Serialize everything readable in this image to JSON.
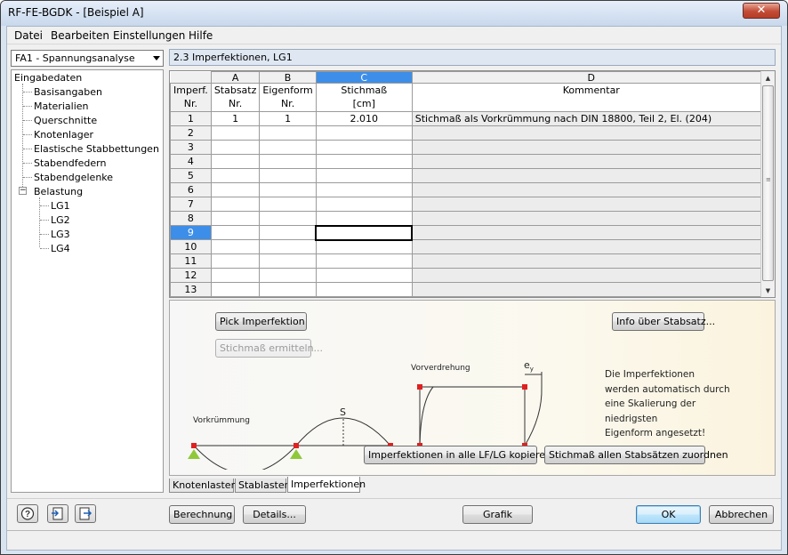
{
  "window": {
    "title": "RF-FE-BGDK - [Beispiel A]",
    "close_label": "✕"
  },
  "menu": [
    "Datei",
    "Bearbeiten",
    "Einstellungen",
    "Hilfe"
  ],
  "case_select": {
    "value": "FA1 - Spannungsanalyse"
  },
  "tree": {
    "root": "Eingabedaten",
    "items": [
      "Basisangaben",
      "Materialien",
      "Querschnitte",
      "Knotenlager",
      "Elastische Stabbettungen",
      "Stabendfedern",
      "Stabendgelenke",
      "Belastung"
    ],
    "load_expander": "−",
    "load_cases": [
      "LG1",
      "LG2",
      "LG3",
      "LG4"
    ]
  },
  "panel_title": "2.3 Imperfektionen, LG1",
  "grid": {
    "col_letters": [
      "A",
      "B",
      "C",
      "D"
    ],
    "header_first": [
      "Imperf.",
      "Nr."
    ],
    "headers": [
      [
        "Stabsatz",
        "Nr."
      ],
      [
        "Eigenform",
        "Nr."
      ],
      [
        "Stichmaß",
        "[cm]"
      ],
      [
        "",
        "Kommentar"
      ]
    ],
    "rows": [
      {
        "nr": "1",
        "a": "1",
        "b": "1",
        "c": "2.010",
        "d": "Stichmaß als Vorkrümmung nach DIN 18800, Teil 2, El. (204)"
      },
      {
        "nr": "2",
        "a": "",
        "b": "",
        "c": "",
        "d": ""
      },
      {
        "nr": "3",
        "a": "",
        "b": "",
        "c": "",
        "d": ""
      },
      {
        "nr": "4",
        "a": "",
        "b": "",
        "c": "",
        "d": ""
      },
      {
        "nr": "5",
        "a": "",
        "b": "",
        "c": "",
        "d": ""
      },
      {
        "nr": "6",
        "a": "",
        "b": "",
        "c": "",
        "d": ""
      },
      {
        "nr": "7",
        "a": "",
        "b": "",
        "c": "",
        "d": ""
      },
      {
        "nr": "8",
        "a": "",
        "b": "",
        "c": "",
        "d": ""
      },
      {
        "nr": "9",
        "a": "",
        "b": "",
        "c": "",
        "d": ""
      },
      {
        "nr": "10",
        "a": "",
        "b": "",
        "c": "",
        "d": ""
      },
      {
        "nr": "11",
        "a": "",
        "b": "",
        "c": "",
        "d": ""
      },
      {
        "nr": "12",
        "a": "",
        "b": "",
        "c": "",
        "d": ""
      },
      {
        "nr": "13",
        "a": "",
        "b": "",
        "c": "",
        "d": ""
      }
    ],
    "selected_row": "9",
    "selected_col": "C"
  },
  "lower": {
    "pick_button": "Pick Imperfektion",
    "ermitteln_button": "Stichmaß ermitteln...",
    "info_button": "Info über Stabsatz...",
    "copy_button": "Imperfektionen in alle LF/LG kopieren",
    "assign_button": "Stichmaß allen Stabsätzen zuordnen",
    "label_vorkruemmung": "Vorkrümmung",
    "label_vorverdrehung": "Vorverdrehung",
    "label_s": "S",
    "label_ey": "e",
    "label_ey_sub": "y",
    "info_lines": [
      "Die Imperfektionen",
      "werden automatisch durch",
      "eine Skalierung der niedrigsten",
      "Eigenform angesetzt!"
    ]
  },
  "tabs": [
    "Knotenlasten",
    "Stablasten",
    "Imperfektionen"
  ],
  "active_tab": "Imperfektionen",
  "bottom": {
    "help_icon": "help-icon",
    "berechnung": "Berechnung",
    "details": "Details...",
    "grafik": "Grafik",
    "ok": "OK",
    "abbrechen": "Abbrechen"
  },
  "colors": {
    "selection": "#3d8ee8",
    "support": "#8fc93a",
    "node": "#e02020"
  }
}
